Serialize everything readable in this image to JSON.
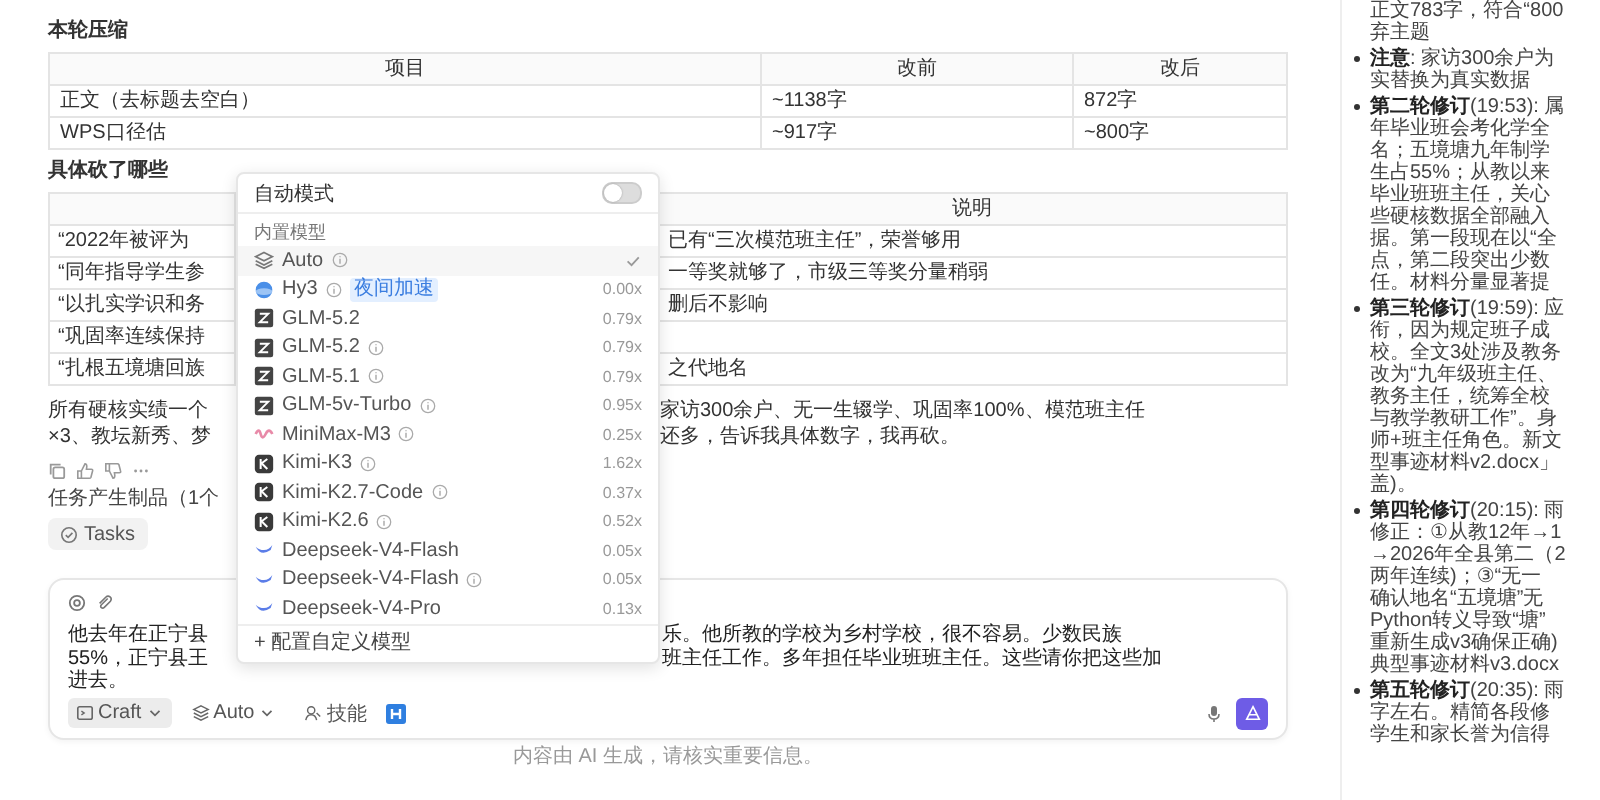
{
  "compression": {
    "heading": "本轮压缩",
    "columns": [
      "项目",
      "改前",
      "改后"
    ],
    "rows": [
      [
        "正文（去标题去空白）",
        "~1138字",
        "872字"
      ],
      [
        "WPS口径估",
        "~917字",
        "~800字"
      ]
    ]
  },
  "cuts": {
    "heading": "具体砍了哪些",
    "header_3": "说明",
    "rows": [
      {
        "left": "“2022年被评为",
        "note": "已有“三次模范班主任”，荣誉够用"
      },
      {
        "left": "“同年指导学生参",
        "note": "一等奖就够了，市级三等奖分量稍弱"
      },
      {
        "left": "“以扎实学识和务",
        "note": "删后不影响"
      },
      {
        "left": "“巩固率连续保持"
      },
      {
        "left": "“扎根五境塘回族",
        "note": "之代地名"
      }
    ]
  },
  "summary": {
    "left_lines": [
      "所有硬核实绩一个",
      "×3、教坛新秀、梦"
    ],
    "right_lines": [
      "家访300余户、无一生辍学、巩固率100%、模范班主任",
      "还多，告诉我具体数字，我再砍。"
    ]
  },
  "artifacts_label": "任务产生制品（1个",
  "tasks_button": "Tasks",
  "composer": {
    "left_lines": [
      "他去年在正宁县",
      "55%，正宁县王"
    ],
    "right_lines": [
      "乐。他所教的学校为乡村学校，很不容易。少数民族",
      "班主任工作。多年担任毕业班班主任。这些请你把这些加"
    ],
    "last_line": "进去。",
    "mode": "Craft",
    "model": "Auto",
    "skills": "技能"
  },
  "disclaimer": "内容由 AI 生成，请核实重要信息。",
  "model_menu": {
    "auto_mode_label": "自动模式",
    "auto_mode_on": false,
    "section": "内置模型",
    "custom": "+ 配置自定义模型",
    "models": [
      {
        "name": "Auto",
        "kind": "auto",
        "info": true,
        "selected": true
      },
      {
        "name": "Hy3",
        "kind": "hy",
        "info": true,
        "badge": "夜间加速",
        "multiplier": "0.00x",
        "selected": false
      },
      {
        "name": "GLM-5.2",
        "kind": "glm",
        "info": false,
        "multiplier": "0.79x",
        "selected": false
      },
      {
        "name": "GLM-5.2",
        "kind": "glm",
        "info": true,
        "multiplier": "0.79x",
        "selected": false
      },
      {
        "name": "GLM-5.1",
        "kind": "glm",
        "info": true,
        "multiplier": "0.79x",
        "selected": false
      },
      {
        "name": "GLM-5v-Turbo",
        "kind": "glm",
        "info": true,
        "multiplier": "0.95x",
        "selected": false
      },
      {
        "name": "MiniMax-M3",
        "kind": "minimax",
        "info": true,
        "multiplier": "0.25x",
        "selected": false
      },
      {
        "name": "Kimi-K3",
        "kind": "kimi",
        "info": true,
        "multiplier": "1.62x",
        "selected": false
      },
      {
        "name": "Kimi-K2.7-Code",
        "kind": "kimi",
        "info": true,
        "multiplier": "0.37x",
        "selected": false
      },
      {
        "name": "Kimi-K2.6",
        "kind": "kimi",
        "info": true,
        "multiplier": "0.52x",
        "selected": false
      },
      {
        "name": "Deepseek-V4-Flash",
        "kind": "deepseek",
        "info": false,
        "multiplier": "0.05x",
        "selected": false
      },
      {
        "name": "Deepseek-V4-Flash",
        "kind": "deepseek",
        "info": true,
        "multiplier": "0.05x",
        "selected": false
      },
      {
        "name": "Deepseek-V4-Pro",
        "kind": "deepseek",
        "info": false,
        "multiplier": "0.13x",
        "selected": false
      }
    ]
  },
  "notes": [
    {
      "bullet": false,
      "lines": [
        "正文783字，符合“800",
        "弃主题"
      ]
    },
    {
      "bullet": true,
      "lines": [
        "**注意**: 家访300余户为",
        "实替换为真实数据"
      ]
    },
    {
      "bullet": true,
      "lines": [
        "**第二轮修订**(19:53): 属",
        "年毕业班会考化学全",
        "名；五境塘九年制学",
        "生占55%；从教以来",
        "毕业班班主任，关心",
        "些硬核数据全部融入",
        "据。第一段现在以“全",
        "点，第二段突出少数",
        "任。材料分量显著提"
      ]
    },
    {
      "bullet": true,
      "lines": [
        "**第三轮修订**(19:59): 应",
        "衔，因为规定班子成",
        "校。全文3处涉及教务",
        "改为“九年级班主任、",
        "教务主任，统筹全校",
        "与教学教研工作”。身",
        "师+班主任角色。新文",
        "型事迹材料v2.docx」",
        "盖)。"
      ]
    },
    {
      "bullet": true,
      "lines": [
        "**第四轮修订**(20:15): 雨",
        "修正：①从教12年→1",
        "→2026年全县第二（2",
        "两年连续)；③“无一",
        "确认地名“五境塘”无",
        "Python转义导致“塘”",
        "重新生成v3确保正确)",
        "典型事迹材料v3.docx"
      ]
    },
    {
      "bullet": true,
      "lines": [
        "**第五轮修订**(20:35): 雨",
        "字左右。精简各段修",
        "学生和家长誉为信得"
      ]
    }
  ]
}
